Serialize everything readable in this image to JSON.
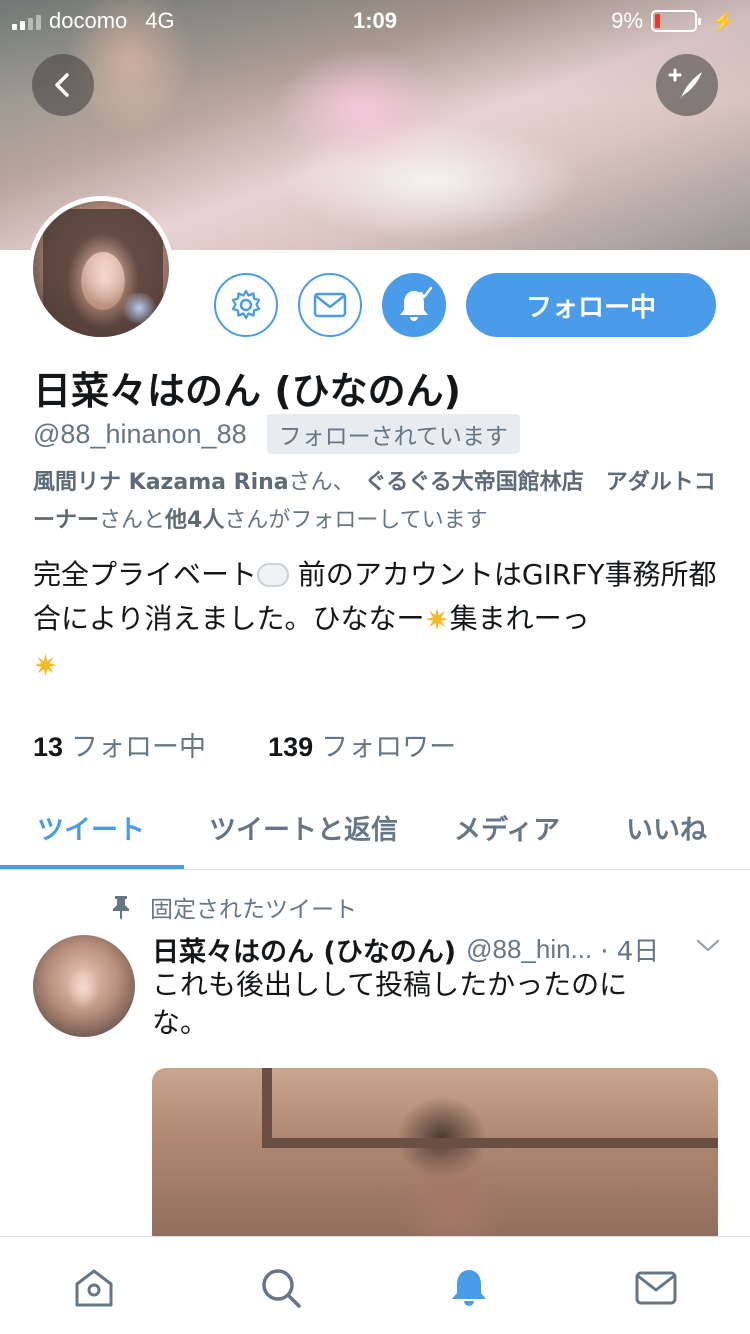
{
  "status_bar": {
    "carrier": "docomo",
    "network": "4G",
    "time": "1:09",
    "battery_percent": "9%",
    "battery_level": 0.09
  },
  "profile": {
    "display_name": "日菜々はのん (ひなのん)",
    "handle": "@88_hinanon_88",
    "follows_you": "フォローされています",
    "follow_button": "フォロー中",
    "known_followers": {
      "name1": "風間リナ Kazama Rina",
      "sep1": "さん、",
      "name2": "ぐるぐる大帝国館林店　アダルトコーナー",
      "rest": "さんと",
      "others": "他4人",
      "suffix": "さんがフォローしています"
    },
    "bio": {
      "part1": "完全プライベート",
      "part2": " 前のアカウントはGIRFY事務所都合により消えました。ひななー",
      "part3": "集まれーっ"
    },
    "following_count": "13",
    "following_label": "フォロー中",
    "followers_count": "139",
    "followers_label": "フォロワー"
  },
  "tabs": [
    {
      "label": "ツイート",
      "active": true
    },
    {
      "label": "ツイートと返信",
      "active": false
    },
    {
      "label": "メディア",
      "active": false
    },
    {
      "label": "いいね",
      "active": false
    }
  ],
  "pinned_tweet": {
    "pinned_label": "固定されたツイート",
    "name": "日菜々はのん (ひなのん)",
    "handle": "@88_hin...",
    "time": "· 4日",
    "text": "これも後出しして投稿したかったのにな。"
  },
  "icons": {
    "back": "back-icon",
    "compose": "compose-icon",
    "settings": "gear-icon",
    "message": "envelope-icon",
    "notifications": "bell-icon",
    "pin": "pin-icon",
    "caret": "chevron-down-icon",
    "nav_home": "home-icon",
    "nav_search": "search-icon",
    "nav_notifications": "bell-icon",
    "nav_messages": "envelope-icon"
  },
  "colors": {
    "accent": "#4a9ce8",
    "secondary_text": "#657786",
    "primary_text": "#14171a"
  }
}
